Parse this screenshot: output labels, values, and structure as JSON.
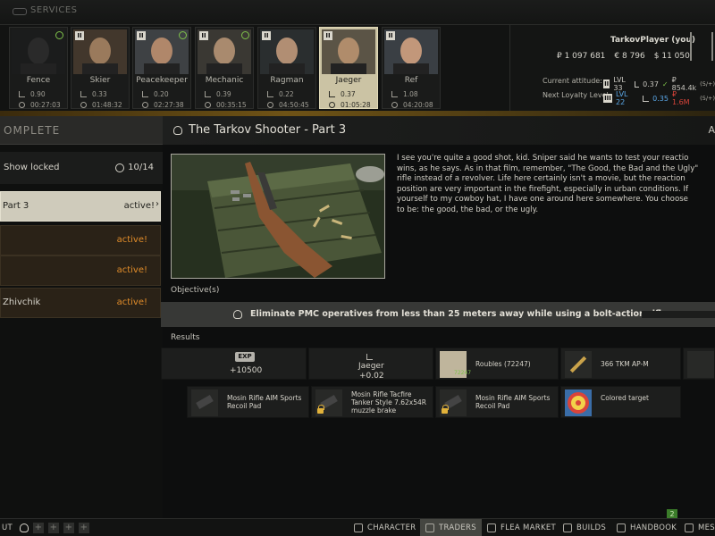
{
  "top": {
    "services_label": "SERVICES"
  },
  "traders": [
    {
      "name": "Fence",
      "level": "",
      "rep": "0.90",
      "timer": "00:27:03",
      "check": true,
      "tint": "#1b1c1c",
      "skin": "#2a2a2a"
    },
    {
      "name": "Skier",
      "level": "II",
      "rep": "0.33",
      "timer": "01:48:32",
      "check": false,
      "tint": "#42372c",
      "skin": "#9a7a5c"
    },
    {
      "name": "Peacekeeper",
      "level": "II",
      "rep": "0.20",
      "timer": "02:27:38",
      "check": true,
      "tint": "#3e4144",
      "skin": "#b0876a"
    },
    {
      "name": "Mechanic",
      "level": "II",
      "rep": "0.39",
      "timer": "00:35:15",
      "check": true,
      "tint": "#3a3833",
      "skin": "#a98a6e"
    },
    {
      "name": "Ragman",
      "level": "II",
      "rep": "0.22",
      "timer": "04:50:45",
      "check": false,
      "tint": "#2a2e2f",
      "skin": "#b18e73"
    },
    {
      "name": "Jaeger",
      "level": "II",
      "rep": "0.37",
      "timer": "01:05:28",
      "check": false,
      "tint": "#5b5446",
      "skin": "#b08c6b",
      "selected": true
    },
    {
      "name": "Ref",
      "level": "II",
      "rep": "1.08",
      "timer": "04:20:08",
      "check": false,
      "tint": "#3a3f44",
      "skin": "#c2977a"
    }
  ],
  "player": {
    "name": "TarkovPlayer (you)",
    "roubles": "₽ 1 097 681",
    "euros": "€ 8 796",
    "dollars": "$ 11 050",
    "attitude_label": "Current attitude:",
    "attitude_level": "II",
    "attitude_lvl": "LVL 33",
    "attitude_rep": "0.37",
    "attitude_money": "₽ 854.4k",
    "attitude_money_sub": "(5/+)",
    "loyalty_label": "Next Loyalty Level:",
    "loyalty_level": "III",
    "loyalty_lvl": "LVL 22",
    "loyalty_rep": "0.35",
    "loyalty_money": "₽ 1.6M",
    "loyalty_money_sub": "(5/+)"
  },
  "left": {
    "complete_tab": "OMPLETE",
    "show_locked": "Show locked",
    "locked_count": "10/14",
    "quests": [
      {
        "name": "Part 3",
        "status": "active!",
        "selected": true
      },
      {
        "name": "",
        "status": "active!"
      },
      {
        "name": "",
        "status": "active!"
      },
      {
        "name": "Zhivchik",
        "status": "active!"
      }
    ]
  },
  "quest": {
    "title": "The Tarkov Shooter - Part 3",
    "header_right": "A",
    "description": "I see you're quite a good shot, kid. Sniper said he wants to test your reactio\nwins, as he says. As in that film, remember, \"The Good, the Bad and the Ugly\"\nrifle instead of a revolver. Life here certainly isn't a movie, but the reaction\nposition are very important in the firefight, especially in urban conditions. If\nyourself to my cowboy hat, I have one around here somewhere. You choose\nto be: the good, the bad, or the ugly.",
    "objectives_label": "Objective(s)",
    "objective": "Eliminate PMC operatives from less than 25 meters away while using a bolt-action rifle",
    "results_label": "Results",
    "exp_badge": "EXP",
    "exp_value": "+10500",
    "rep_trader": "Jaeger",
    "rep_value": "+0.02",
    "roubles_item": "Roubles (72247)",
    "roubles_count": "72247",
    "ammo_item": "366 TKM AP-M",
    "rewards_row2": [
      {
        "label": "Mosin Rifle AIM Sports Recoil Pad",
        "lock": false
      },
      {
        "label": "Mosin Rifle Tacfire Tanker Style 7.62x54R muzzle brake",
        "lock": true
      },
      {
        "label": "Mosin Rifle AIM Sports Recoil Pad",
        "lock": true
      },
      {
        "label": "Colored target",
        "lock": false
      }
    ]
  },
  "bottom": {
    "left_label": "UT",
    "nav": [
      "CHARACTER",
      "TRADERS",
      "FLEA MARKET",
      "BUILDS",
      "HANDBOOK",
      "MESS"
    ],
    "message_count": "2"
  },
  "colors": {
    "accent_orange": "#e08c2a",
    "active_tab": "#cfcbbb",
    "amber_line": "#6f5316",
    "lock_gold": "#e2b23a",
    "badge_green": "#3b7c2a"
  }
}
